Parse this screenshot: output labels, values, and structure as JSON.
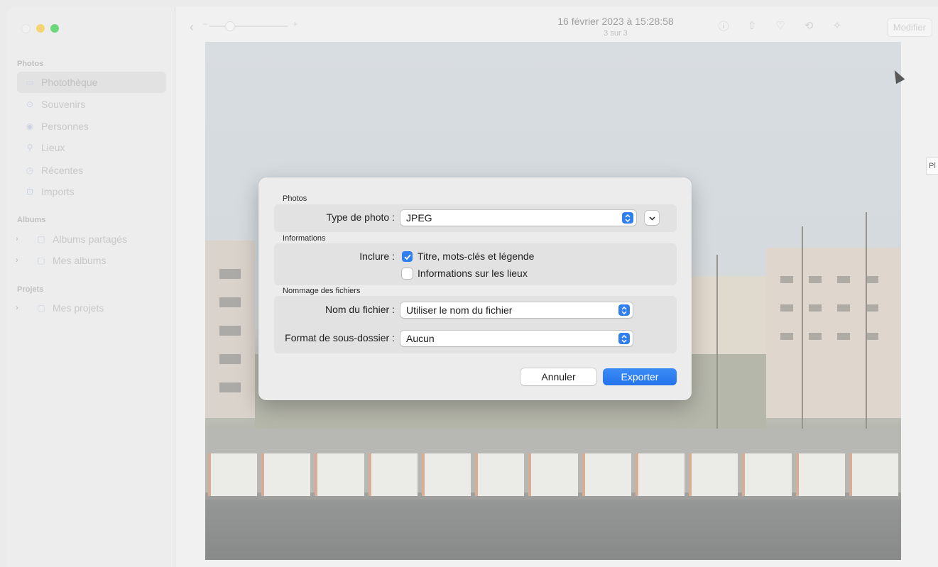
{
  "sidebar": {
    "sections": [
      {
        "label": "Photos"
      },
      {
        "label": "Albums"
      },
      {
        "label": "Projets"
      }
    ],
    "items": [
      {
        "label": "Photothèque",
        "icon": "photo-library-icon"
      },
      {
        "label": "Souvenirs",
        "icon": "memories-icon"
      },
      {
        "label": "Personnes",
        "icon": "people-icon"
      },
      {
        "label": "Lieux",
        "icon": "places-icon"
      },
      {
        "label": "Récentes",
        "icon": "recents-icon"
      },
      {
        "label": "Imports",
        "icon": "imports-icon"
      },
      {
        "label": "Albums partagés",
        "icon": "shared-albums-icon"
      },
      {
        "label": "Mes albums",
        "icon": "folder-icon"
      },
      {
        "label": "Mes projets",
        "icon": "folder-icon"
      }
    ]
  },
  "toolbar": {
    "title": "16 février 2023 à 15:28:58",
    "subtitle": "3 sur 3",
    "modifier_label": "Modifier",
    "tooltip": "Pl"
  },
  "dialog": {
    "photos_section": "Photos",
    "photo_type_label": "Type de photo :",
    "photo_type_value": "JPEG",
    "info_section": "Informations",
    "include_label": "Inclure :",
    "opt_title_keywords": "Titre, mots-clés et légende",
    "opt_title_keywords_checked": true,
    "opt_location": "Informations sur les lieux",
    "opt_location_checked": false,
    "naming_section": "Nommage des fichiers",
    "filename_label": "Nom du fichier :",
    "filename_value": "Utiliser le nom du fichier",
    "subfolder_label": "Format de sous-dossier :",
    "subfolder_value": "Aucun",
    "cancel_label": "Annuler",
    "export_label": "Exporter"
  },
  "colors": {
    "accent": "#2f7ff0",
    "traffic_close": "#ececec",
    "traffic_min": "#f5c33b",
    "traffic_max": "#35c84a"
  }
}
